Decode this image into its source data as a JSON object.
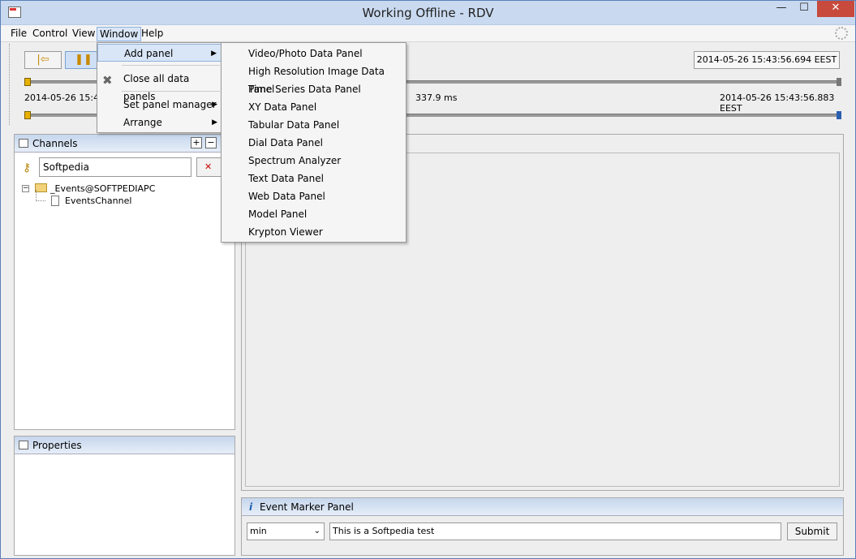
{
  "window": {
    "title": "Working Offline - RDV",
    "minimize": "—",
    "maximize": "☐",
    "close": "✕"
  },
  "menubar": {
    "items": [
      "File",
      "Control",
      "View",
      "Window",
      "Help"
    ],
    "active": "Window"
  },
  "toolbar": {
    "timestamp_box": "2014-05-26 15:43:56.694 EEST",
    "start_time": "2014-05-26 15:43:",
    "duration": "337.9 ms",
    "end_time": "2014-05-26 15:43:56.883 EEST"
  },
  "channels": {
    "title": "Channels",
    "search_value": "Softpedia",
    "tree": {
      "root": "_Events@SOFTPEDIAPC",
      "child": "EventsChannel"
    }
  },
  "properties": {
    "title": "Properties"
  },
  "event_marker": {
    "title": "Event Marker Panel",
    "info_icon": "i",
    "select_value": "min",
    "input_value": "This is a Softpedia test",
    "submit_label": "Submit"
  },
  "window_menu": {
    "items": [
      {
        "label": "Add panel",
        "submenu": true
      },
      {
        "label": "Close all data panels",
        "submenu": false
      },
      {
        "label": "Set panel manager",
        "submenu": true
      },
      {
        "label": "Arrange",
        "submenu": true
      }
    ]
  },
  "add_panel_submenu": {
    "items": [
      "Video/Photo Data Panel",
      "High Resolution Image Data Panel",
      "Time Series Data Panel",
      "XY Data Panel",
      "Tabular Data Panel",
      "Dial Data Panel",
      "Spectrum Analyzer",
      "Text Data Panel",
      "Web Data Panel",
      "Model Panel",
      "Krypton Viewer"
    ]
  }
}
